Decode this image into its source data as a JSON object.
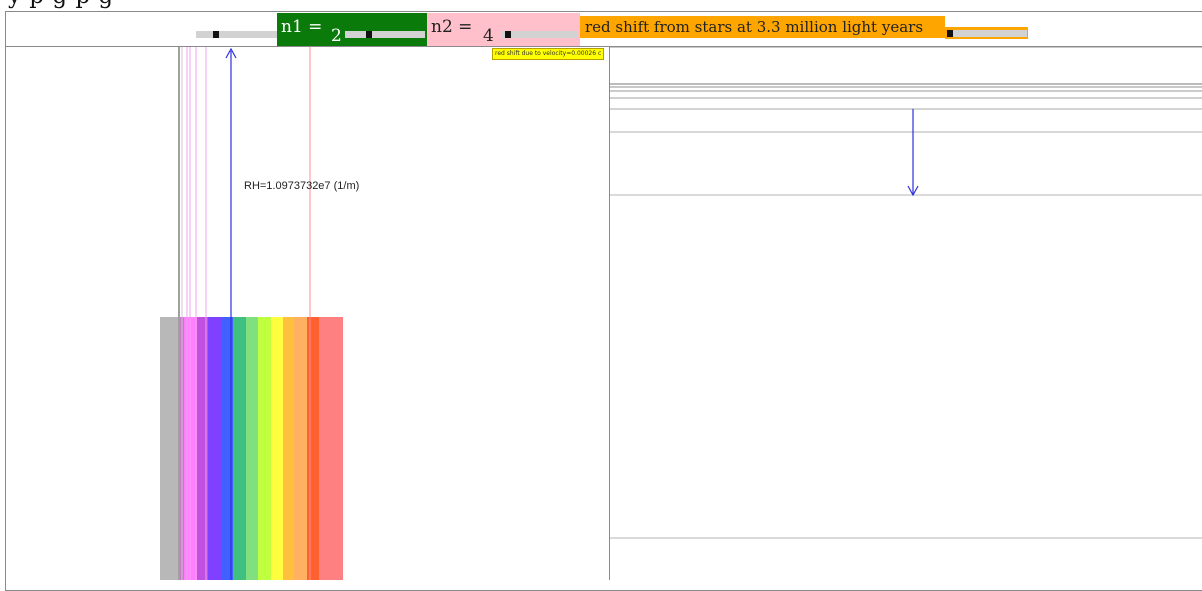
{
  "header": {
    "clipped_text": "y  p      g      p  g"
  },
  "controls": {
    "n1": {
      "label": "n1 =",
      "value": "2",
      "color": "#0a7a0a"
    },
    "n2": {
      "label": "n2 =",
      "value": "4",
      "color": "#ffc0cb"
    },
    "redshift": {
      "label": "red shift from stars at 3.3 million light years",
      "color": "#ffa500"
    },
    "redshift_badge": "red shift due to velocity=0.00026 c"
  },
  "spectrum": {
    "rh_label": "RH=1.0973732e7 (1/m)",
    "band_colors": [
      "#b8b8b8",
      "#c878c8",
      "#ff80ff",
      "#c050e0",
      "#8040ff",
      "#4060ff",
      "#40c080",
      "#80e080",
      "#c0ff40",
      "#ffff40",
      "#ffc040",
      "#ffb060",
      "#ff6030",
      "#ff8080"
    ]
  },
  "energy_levels": {
    "transition_color": "#3030e0"
  }
}
